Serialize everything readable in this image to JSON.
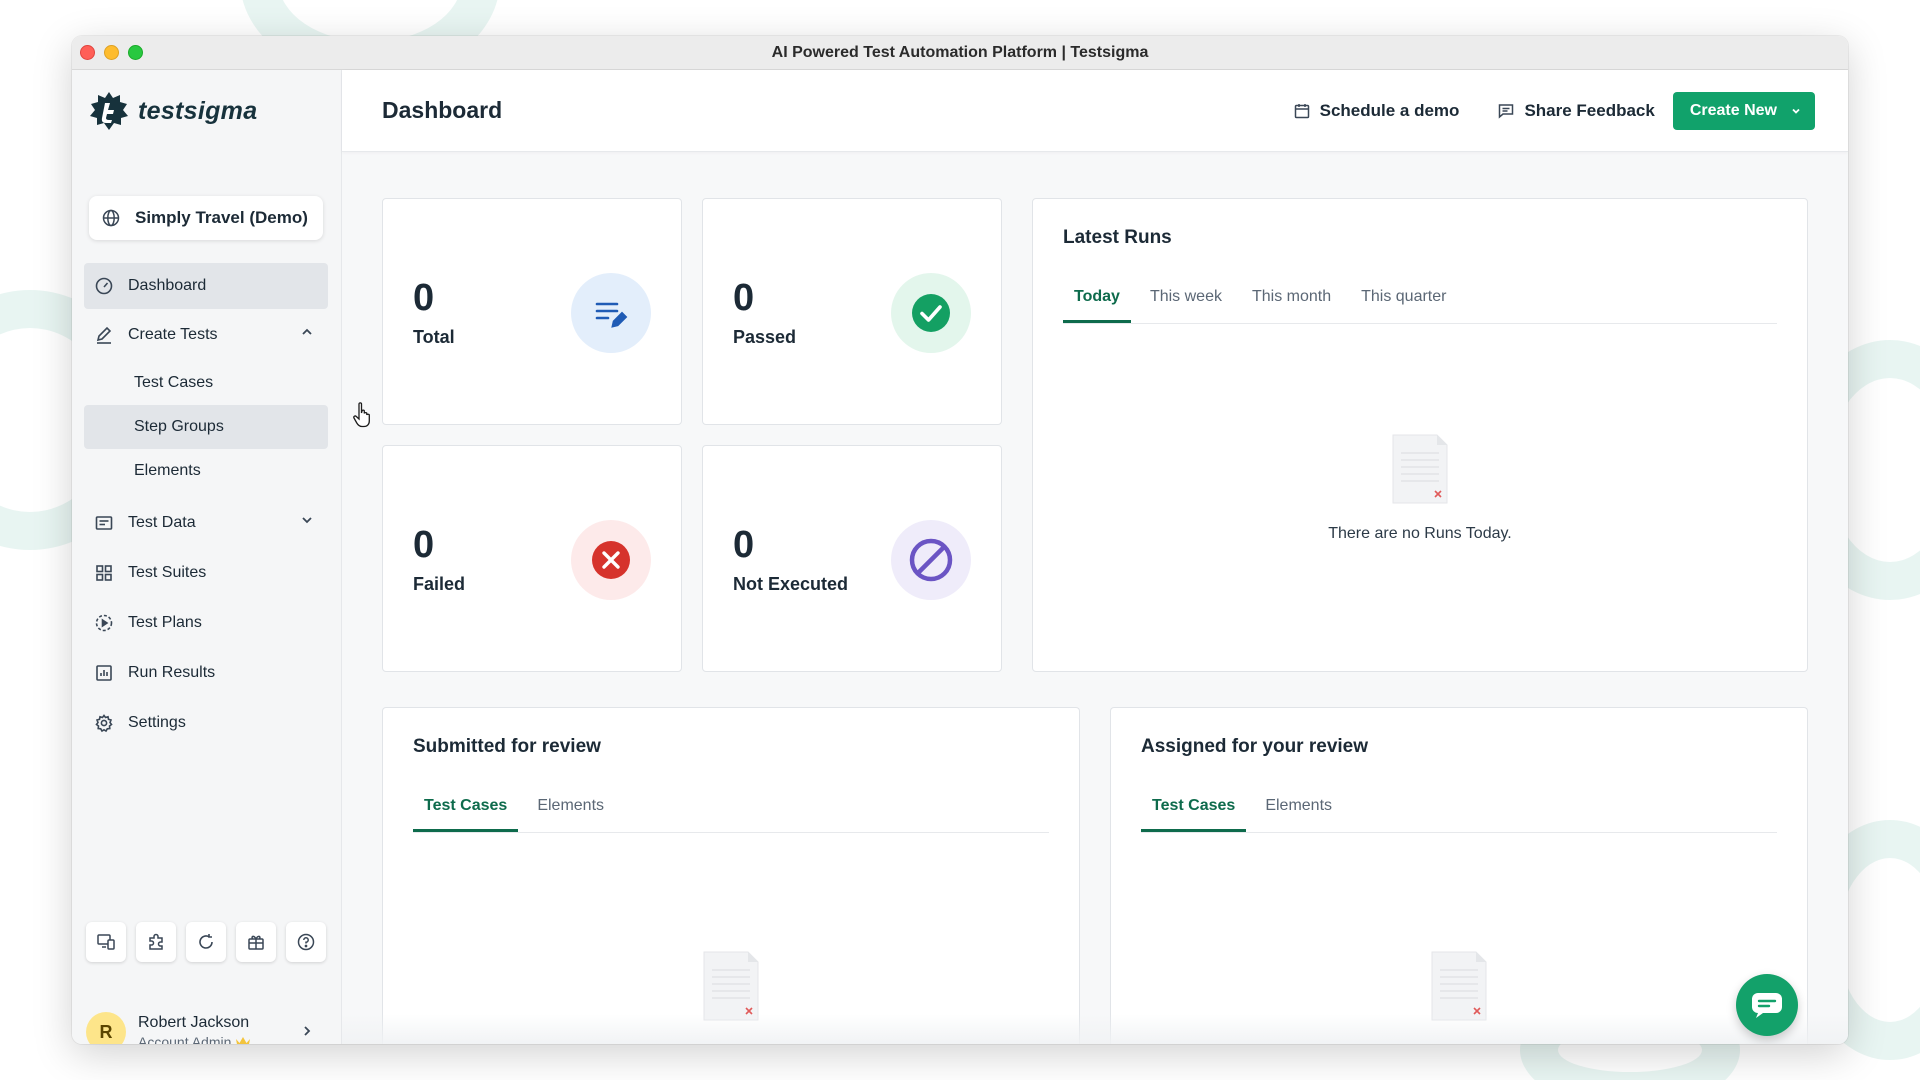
{
  "window": {
    "title": "AI Powered Test Automation Platform | Testsigma"
  },
  "brand": {
    "name": "testsigma",
    "accent": "#11a26b"
  },
  "project": {
    "name": "Simply Travel (Demo)",
    "icon": "globe-icon"
  },
  "sidebar": {
    "items": [
      {
        "label": "Dashboard",
        "icon": "gauge-icon",
        "active": true
      },
      {
        "label": "Create Tests",
        "icon": "pencil-icon",
        "expanded": true,
        "children": [
          {
            "label": "Test Cases"
          },
          {
            "label": "Step Groups"
          },
          {
            "label": "Elements"
          }
        ]
      },
      {
        "label": "Test Data",
        "icon": "folder-icon",
        "expanded": false
      },
      {
        "label": "Test Suites",
        "icon": "grid-icon"
      },
      {
        "label": "Test Plans",
        "icon": "play-circle-icon"
      },
      {
        "label": "Run Results",
        "icon": "bar-chart-icon"
      },
      {
        "label": "Settings",
        "icon": "gear-icon"
      }
    ],
    "tools": [
      "devices-icon",
      "puzzle-icon",
      "refresh-icon",
      "gift-icon",
      "help-icon"
    ]
  },
  "user": {
    "initial": "R",
    "name": "Robert Jackson",
    "role": "Account Admin"
  },
  "header": {
    "title": "Dashboard",
    "schedule_label": "Schedule a demo",
    "feedback_label": "Share Feedback",
    "create_label": "Create New"
  },
  "stats": [
    {
      "value": "0",
      "label": "Total",
      "icon": "list-edit-icon",
      "color": "#1f5bb5",
      "bg": "#e3eefb"
    },
    {
      "value": "0",
      "label": "Passed",
      "icon": "check-circle-icon",
      "color": "#14a063",
      "bg": "#e3f6ec"
    },
    {
      "value": "0",
      "label": "Failed",
      "icon": "x-circle-icon",
      "color": "#d6332c",
      "bg": "#fdeaea"
    },
    {
      "value": "0",
      "label": "Not Executed",
      "icon": "ban-icon",
      "color": "#6b55c4",
      "bg": "#efecfa"
    }
  ],
  "latest_runs": {
    "title": "Latest Runs",
    "tabs": [
      "Today",
      "This week",
      "This month",
      "This quarter"
    ],
    "active_tab": "Today",
    "empty_text": "There are no Runs Today."
  },
  "submitted": {
    "title": "Submitted for review",
    "tabs": [
      "Test Cases",
      "Elements"
    ],
    "active_tab": "Test Cases"
  },
  "assigned": {
    "title": "Assigned for your review",
    "tabs": [
      "Test Cases",
      "Elements"
    ],
    "active_tab": "Test Cases"
  }
}
